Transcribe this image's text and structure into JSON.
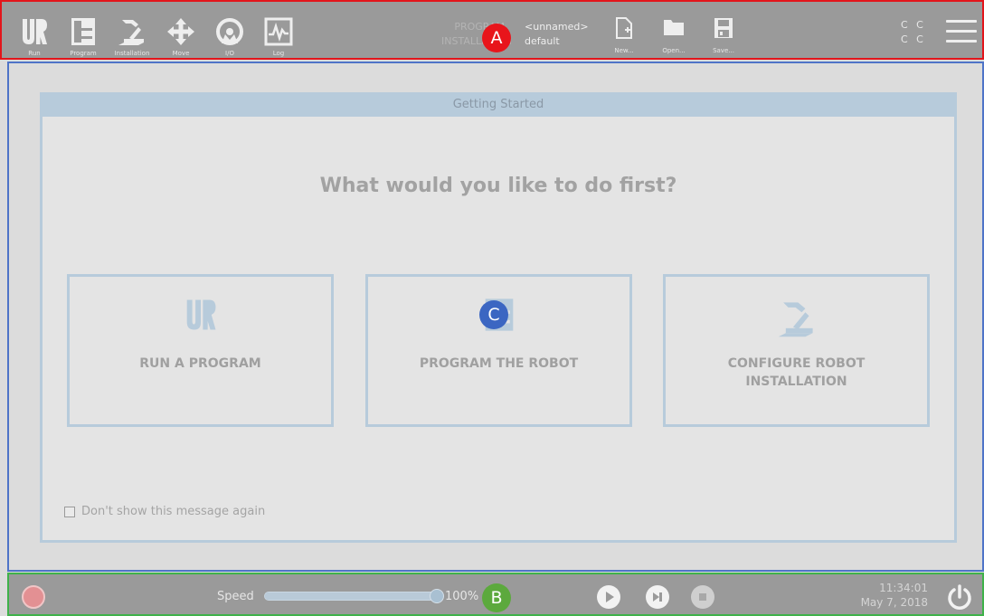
{
  "nav": [
    {
      "label": "Run",
      "icon": "ur-logo-icon"
    },
    {
      "label": "Program",
      "icon": "program-icon"
    },
    {
      "label": "Installation",
      "icon": "robot-arm-icon"
    },
    {
      "label": "Move",
      "icon": "move-arrows-icon"
    },
    {
      "label": "I/O",
      "icon": "io-gauge-icon"
    },
    {
      "label": "Log",
      "icon": "log-chart-icon"
    }
  ],
  "program_info": {
    "program_label": "PROGRAM",
    "installation_label": "INSTALLATION",
    "program_value": "<unnamed>",
    "installation_value": "default"
  },
  "file": {
    "new_label": "New...",
    "open_label": "Open...",
    "save_label": "Save..."
  },
  "status": {
    "line1": "C C",
    "line2": "C C"
  },
  "badges": {
    "a": "A",
    "b": "B",
    "c": "C"
  },
  "dialog": {
    "title": "Getting Started",
    "question": "What would you like to do first?",
    "choices": [
      {
        "label": "RUN A PROGRAM",
        "icon": "ur-logo-icon"
      },
      {
        "label": "PROGRAM THE ROBOT",
        "icon": "program-icon"
      },
      {
        "label": "CONFIGURE ROBOT\nINSTALLATION",
        "icon": "robot-arm-icon"
      }
    ],
    "dont_show_label": "Don't show this message again",
    "dont_show_checked": false
  },
  "footer": {
    "speed_label": "Speed",
    "speed_value": "100%",
    "speed_fraction": 1.0,
    "time": "11:34:01",
    "date": "May 7, 2018"
  },
  "colors": {
    "header_border": "#e3151b",
    "content_border": "#4f74c8",
    "footer_border": "#3fb24a",
    "accent_blue": "#b7cbdb"
  }
}
